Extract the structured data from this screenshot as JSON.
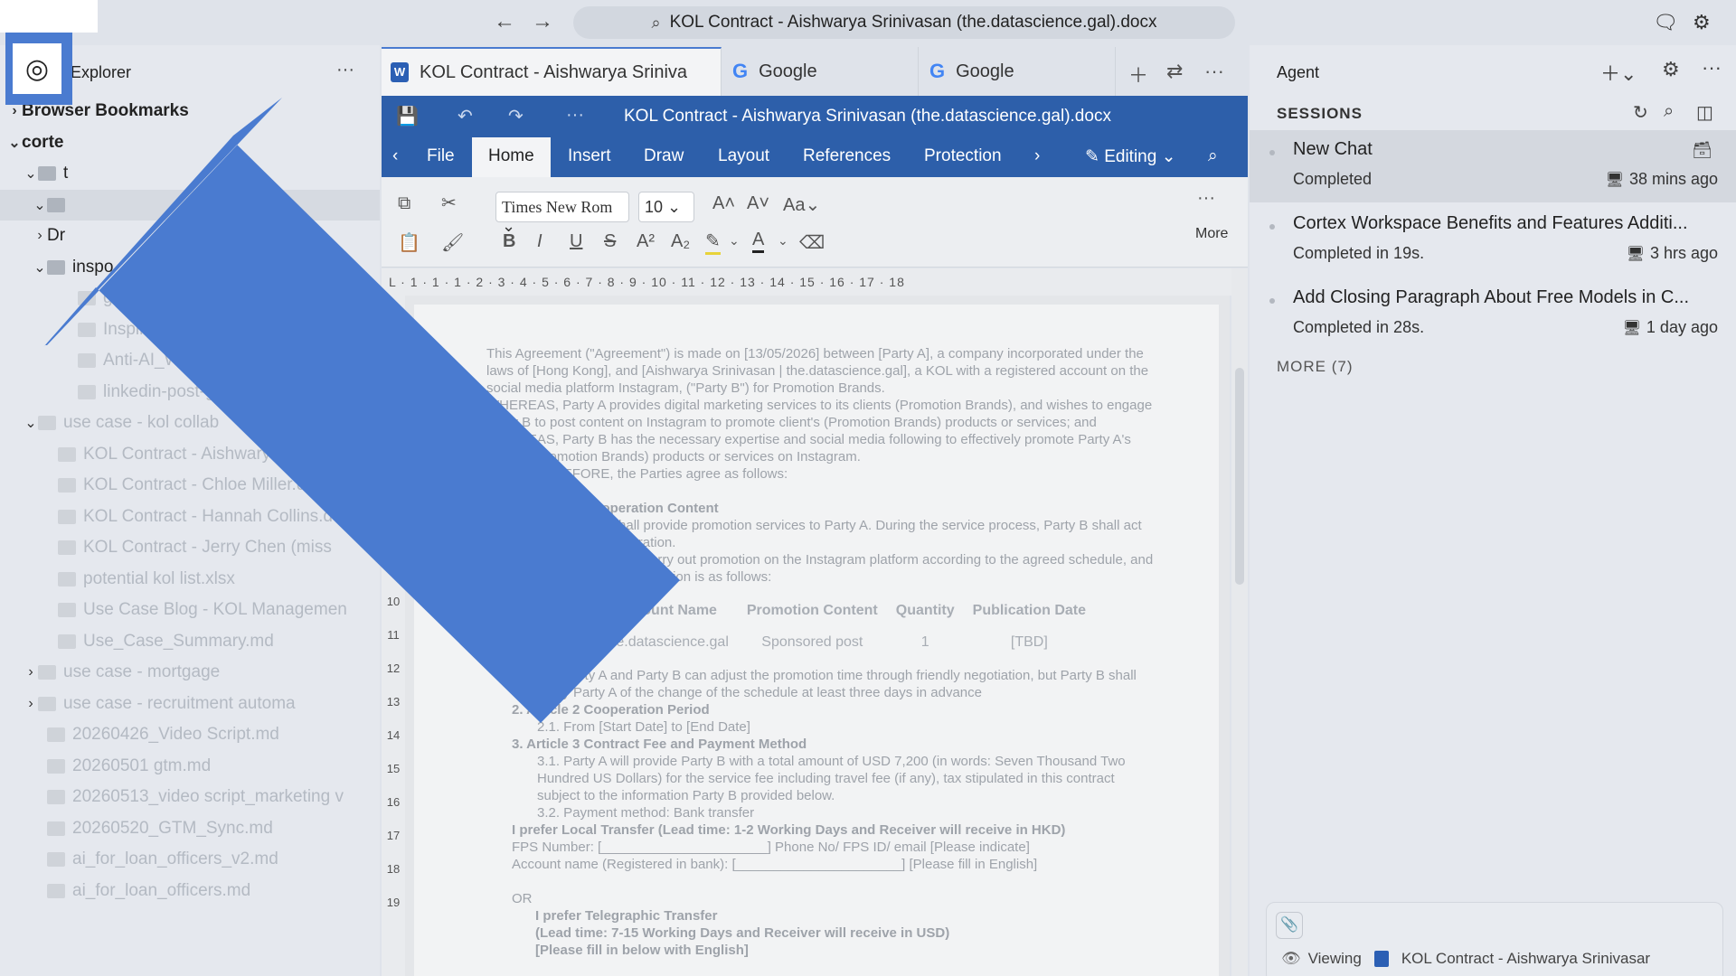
{
  "topbar": {
    "url_text": "KOL Contract - Aishwarya Srinivasan (the.datascience.gal).docx",
    "back_icon": "arrow-left-icon",
    "forward_icon": "arrow-right-icon"
  },
  "sidebar": {
    "title": "Explorer",
    "more": "···",
    "rows": [
      {
        "label": "Browser Bookmarks",
        "chev": "›",
        "style": "bold",
        "icon": false
      },
      {
        "label": "corte",
        "chev": "⌄",
        "style": "bold",
        "icon": false
      },
      {
        "label": "t",
        "chev": "⌄",
        "style": "",
        "icon": true
      },
      {
        "label": "",
        "chev": "⌄",
        "style": "selected",
        "icon": true
      },
      {
        "label": "Dr",
        "chev": "›",
        "style": "",
        "icon": false
      },
      {
        "label": "inspo",
        "chev": "⌄",
        "style": "",
        "icon": true
      },
      {
        "label": "good-p",
        "chev": "",
        "style": "dim",
        "icon": true
      },
      {
        "label": "Inspiration_",
        "chev": "",
        "style": "dim",
        "icon": true
      },
      {
        "label": "Anti-AI_Writing_",
        "chev": "",
        "style": "dim",
        "icon": true
      },
      {
        "label": "linkedin-post-guideli",
        "chev": "",
        "style": "dim",
        "icon": true
      },
      {
        "label": "use case - kol collab",
        "chev": "⌄",
        "style": "dim",
        "icon": true
      },
      {
        "label": "KOL Contract - Aishwarya S",
        "chev": "",
        "style": "dim",
        "icon": true
      },
      {
        "label": "KOL Contract - Chloe Miller.doc",
        "chev": "",
        "style": "dim",
        "icon": true
      },
      {
        "label": "KOL Contract - Hannah Collins.d",
        "chev": "",
        "style": "dim",
        "icon": true
      },
      {
        "label": "KOL Contract - Jerry Chen (miss",
        "chev": "",
        "style": "dim",
        "icon": true
      },
      {
        "label": "potential kol list.xlsx",
        "chev": "",
        "style": "dim",
        "icon": true
      },
      {
        "label": "Use Case Blog - KOL Managemen",
        "chev": "",
        "style": "dim",
        "icon": true
      },
      {
        "label": "Use_Case_Summary.md",
        "chev": "",
        "style": "dim",
        "icon": true
      },
      {
        "label": "use case - mortgage",
        "chev": "›",
        "style": "dim",
        "icon": true
      },
      {
        "label": "use case - recruitment automa",
        "chev": "›",
        "style": "dim",
        "icon": true
      },
      {
        "label": "20260426_Video Script.md",
        "chev": "",
        "style": "dim",
        "icon": true
      },
      {
        "label": "20260501 gtm.md",
        "chev": "",
        "style": "dim",
        "icon": true
      },
      {
        "label": "20260513_video script_marketing v",
        "chev": "",
        "style": "dim",
        "icon": true
      },
      {
        "label": "20260520_GTM_Sync.md",
        "chev": "",
        "style": "dim",
        "icon": true
      },
      {
        "label": "ai_for_loan_officers_v2.md",
        "chev": "",
        "style": "dim",
        "icon": true
      },
      {
        "label": "ai_for_loan_officers.md",
        "chev": "",
        "style": "dim",
        "icon": true
      }
    ]
  },
  "tabs": [
    {
      "label": "KOL Contract - Aishwarya Sriniva",
      "type": "word"
    },
    {
      "label": "Google",
      "type": "google"
    },
    {
      "label": "Google",
      "type": "google"
    }
  ],
  "doc": {
    "title": "KOL Contract - Aishwarya Srinivasan (the.datascience.gal).docx",
    "ribbon_tabs": [
      "File",
      "Home",
      "Insert",
      "Draw",
      "Layout",
      "References",
      "Protection"
    ],
    "active_tab": "Home",
    "editing_label": "Editing",
    "font_name": "Times New Rom",
    "font_size": "10",
    "more_label": "More",
    "ruler": "L · 1 · 1 · 1 · 2 · 3 · 4 · 5 · 6 · 7 · 8 · 9 · 10 · 11 · 12 · 13 · 14 · 15 · 16 · 17 · 18",
    "vruler": [
      "10",
      "11",
      "12",
      "13",
      "14",
      "15",
      "16",
      "17",
      "18",
      "19"
    ],
    "paragraphs": [
      "This Agreement (\"Agreement\") is made on [13/05/2026] between [Party A], a company incorporated under the laws of [Hong Kong], and [Aishwarya Srinivasan | the.datascience.gal], a KOL with a registered account on the social media platform Instagram, (\"Party B\") for Promotion Brands.",
      "WHEREAS, Party A provides digital marketing services to its clients (Promotion Brands), and wishes to engage Party B to post content on Instagram to promote client's (Promotion Brands) products or services; and",
      "WHEREAS, Party B has the necessary expertise and social media following to effectively promote Party A's client's (Promotion Brands) products or services on Instagram.",
      "NOW, THEREFORE, the Parties agree as follows:"
    ],
    "article1_heading": "1. Article 1 Cooperation Content",
    "article1_text": "1.1. Party B shall provide promotion services to Party A. During the service process, Party B shall act as per the cooperation.",
    "article1_text2": "1.2. Party B shall carry out promotion on the Instagram platform according to the agreed schedule, and the promotion information is as follows:",
    "table_headers": [
      "Account Name",
      "Promotion Content",
      "Quantity",
      "Publication Date"
    ],
    "table_row": [
      "the.datascience.gal",
      "Sponsored post",
      "1",
      "[TBD]"
    ],
    "after_table": "1.3. Party A and Party B can adjust the promotion time through friendly negotiation, but Party B shall notify Party A of the change of the schedule at least three days in advance",
    "article2_heading": "2. Article 2 Cooperation Period",
    "article2_text": "2.1. From [Start Date] to [End Date]",
    "article3_heading": "3. Article 3 Contract Fee and Payment Method",
    "article3_text": "3.1. Party A will provide Party B with a total amount of USD 7,200 (in words: Seven Thousand Two Hundred US Dollars) for the service fee including travel fee (if any), tax stipulated in this contract subject to the information Party B provided below.",
    "article3_text2": "3.2. Payment method: Bank transfer",
    "local_transfer": "I prefer Local Transfer (Lead time: 1-2 Working Days and Receiver will receive in HKD)",
    "fps_line": "FPS Number: [______________________] Phone No/ FPS ID/ email [Please indicate]",
    "account_line": "Account name (Registered in bank): [______________________] [Please fill in English]",
    "or_line": "OR",
    "tele_1": "I prefer Telegraphic Transfer",
    "tele_2": "(Lead time: 7-15 Working Days and Receiver will receive in USD)",
    "tele_3": "[Please fill in below with English]"
  },
  "agent": {
    "title": "Agent",
    "sessions_title": "SESSIONS",
    "sessions": [
      {
        "title": "New Chat",
        "status": "Completed",
        "time": "38 mins ago"
      },
      {
        "title": "Cortex Workspace Benefits and Features Additi...",
        "status": "Completed in 19s.",
        "time": "3 hrs ago"
      },
      {
        "title": "Add Closing Paragraph About Free Models in C...",
        "status": "Completed in 28s.",
        "time": "1 day ago"
      }
    ],
    "more_label": "MORE (7)",
    "viewing_label": "Viewing",
    "viewing_file": "KOL Contract - Aishwarya Srinivasar"
  },
  "colors": {
    "accent": "#4a7bd0",
    "doc_header": "#2d5faa",
    "arrow": "#4a7bd0"
  }
}
